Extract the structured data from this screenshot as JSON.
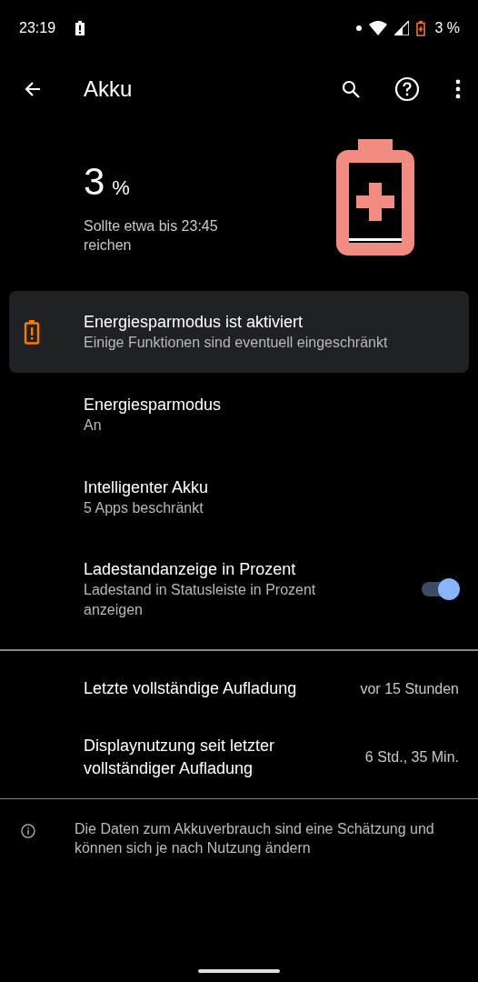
{
  "status_bar": {
    "time": "23:19",
    "battery_percent": "3 %"
  },
  "toolbar": {
    "title": "Akku"
  },
  "summary": {
    "percent": "3",
    "unit": "%",
    "estimate": "Sollte etwa bis 23:45 reichen"
  },
  "banner": {
    "title": "Energiesparmodus ist aktiviert",
    "subtitle": "Einige Funktionen sind eventuell eingeschränkt"
  },
  "settings": [
    {
      "kind": "text",
      "title": "Energiesparmodus",
      "subtitle": "An"
    },
    {
      "kind": "text",
      "title": "Intelligenter Akku",
      "subtitle": "5 Apps beschränkt"
    },
    {
      "kind": "toggle",
      "title": "Ladestandanzeige in Prozent",
      "subtitle": "Ladestand in Statusleiste in Prozent anzeigen",
      "on": true
    }
  ],
  "usage": [
    {
      "label": "Letzte vollständige Aufladung",
      "value": "vor 15 Stunden"
    },
    {
      "label": "Displaynutzung seit letzter vollständiger Aufladung",
      "value": "6 Std., 35 Min."
    }
  ],
  "info": "Die Daten zum Akkuverbrauch sind eine Schätzung und können sich je nach Nutzung ändern"
}
